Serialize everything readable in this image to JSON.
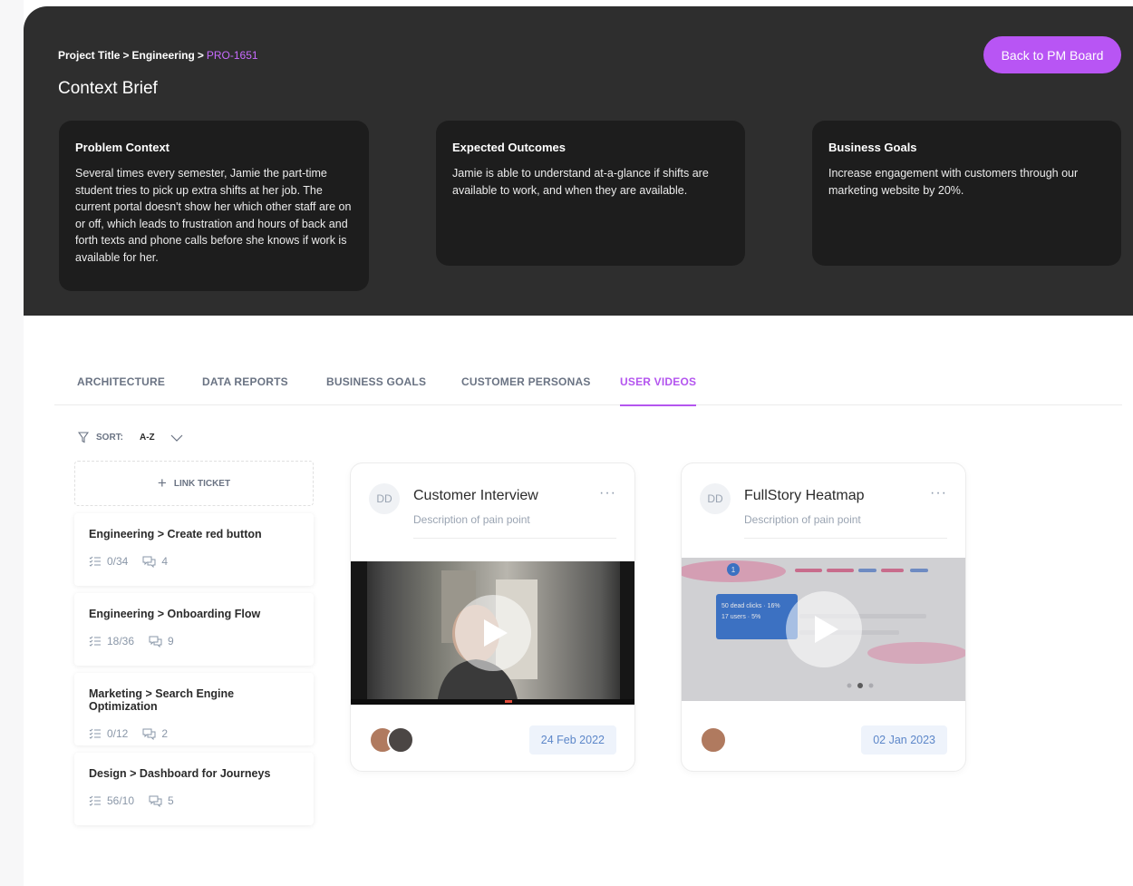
{
  "breadcrumb": {
    "part1": "Project Title",
    "sep": ">",
    "part2": "Engineering",
    "current": "PRO-1651"
  },
  "page_title": "Context Brief",
  "back_button": "Back to PM Board",
  "brief_cards": [
    {
      "title": "Problem Context",
      "body": "Several times every semester, Jamie the part-time student tries to pick up extra shifts at her job.  The current portal doesn't show her which other staff are on or off, which leads to frustration and hours of back and forth texts and phone calls before she knows if work is available for her."
    },
    {
      "title": "Expected Outcomes",
      "body": "Jamie is able to understand at-a-glance if shifts are available to work, and when they are available."
    },
    {
      "title": "Business Goals",
      "body": "Increase engagement with customers through our marketing website by 20%."
    }
  ],
  "tabs": [
    {
      "label": "ARCHITECTURE",
      "active": false
    },
    {
      "label": "DATA REPORTS",
      "active": false
    },
    {
      "label": "BUSINESS GOALS",
      "active": false
    },
    {
      "label": "CUSTOMER PERSONAS",
      "active": false
    },
    {
      "label": "USER VIDEOS",
      "active": true
    }
  ],
  "sort": {
    "label": "SORT:",
    "value": "A-Z"
  },
  "link_ticket": "LINK TICKET",
  "tickets": [
    {
      "title": "Engineering > Create red button",
      "progress": "0/34",
      "comments": "4"
    },
    {
      "title": "Engineering > Onboarding Flow",
      "progress": "18/36",
      "comments": "9"
    },
    {
      "title": "Marketing > Search Engine Optimization",
      "progress": "0/12",
      "comments": "2"
    },
    {
      "title": "Design > Dashboard for Journeys",
      "progress": "56/10",
      "comments": "5"
    }
  ],
  "videos": [
    {
      "initials": "DD",
      "title": "Customer Interview",
      "description": "Description of pain point",
      "date": "24 Feb 2022"
    },
    {
      "initials": "DD",
      "title": "FullStory Heatmap",
      "description": "Description of pain point",
      "date": "02 Jan 2023",
      "overlay_line1": "50 dead clicks · 16%",
      "overlay_line2": "17 users · 5%",
      "overlay_badge": "1"
    }
  ],
  "colors": {
    "accent": "#b855f4",
    "header_bg": "#2e2e2e",
    "card_bg": "#1d1d1d",
    "date_bg": "#eef3fb",
    "date_text": "#5d87c9"
  }
}
